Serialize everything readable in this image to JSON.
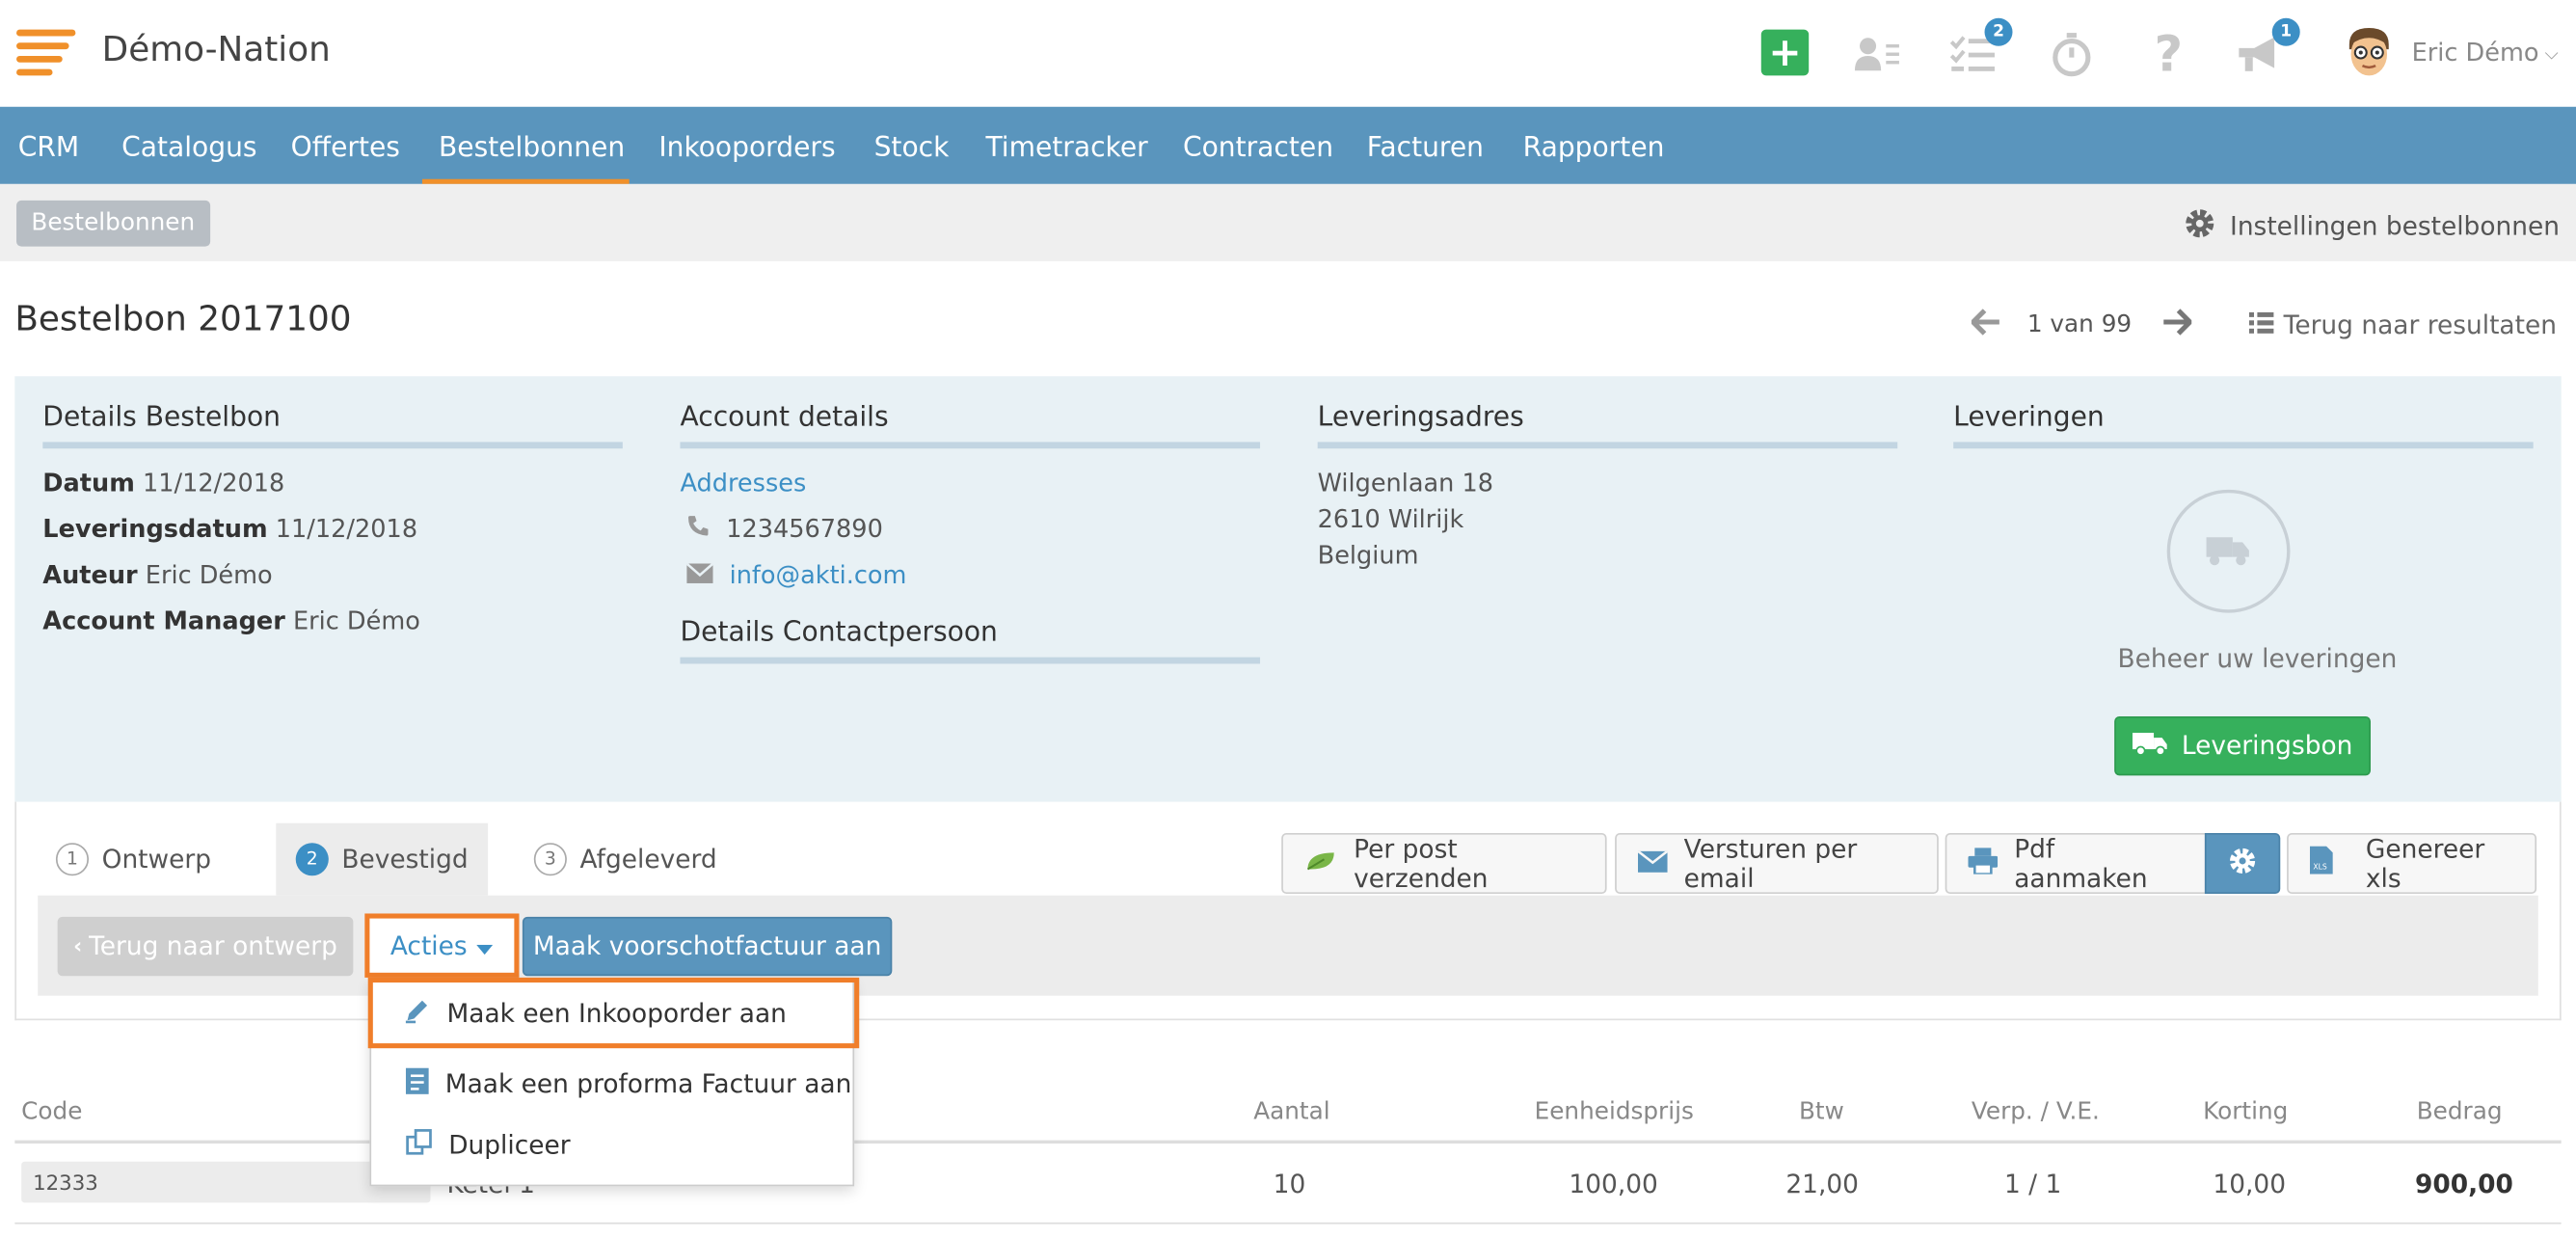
{
  "app": {
    "title": "Démo-Nation"
  },
  "topbar": {
    "tasks_badge": "2",
    "announce_badge": "1",
    "user_name": "Eric Démo"
  },
  "nav": [
    "CRM",
    "Catalogus",
    "Offertes",
    "Bestelbonnen",
    "Inkooporders",
    "Stock",
    "Timetracker",
    "Contracten",
    "Facturen",
    "Rapporten"
  ],
  "nav_active": "Bestelbonnen",
  "subbar": {
    "breadcrumb": "Bestelbonnen",
    "settings": "Instellingen bestelbonnen"
  },
  "page": {
    "title": "Bestelbon 2017100",
    "pager": "1 van 99",
    "back": "Terug naar resultaten"
  },
  "details": {
    "heading": "Details Bestelbon",
    "rows": [
      {
        "label": "Datum",
        "value": "11/12/2018"
      },
      {
        "label": "Leveringsdatum",
        "value": "11/12/2018"
      },
      {
        "label": "Auteur",
        "value": "Eric Démo"
      },
      {
        "label": "Account Manager",
        "value": "Eric Démo"
      }
    ]
  },
  "account": {
    "heading": "Account details",
    "addresses": "Addresses",
    "phone": "1234567890",
    "email": "info@akti.com",
    "contact_heading": "Details Contactpersoon"
  },
  "delivery_address": {
    "heading": "Leveringsadres",
    "lines": [
      "Wilgenlaan 18",
      "2610 Wilrijk",
      "Belgium"
    ]
  },
  "deliveries": {
    "heading": "Leveringen",
    "text": "Beheer uw leveringen",
    "button": "Leveringsbon"
  },
  "steps": [
    {
      "num": "1",
      "label": "Ontwerp"
    },
    {
      "num": "2",
      "label": "Bevestigd"
    },
    {
      "num": "3",
      "label": "Afgeleverd"
    }
  ],
  "toolbar": {
    "post": "Per post verzenden",
    "email": "Versturen per email",
    "pdf": "Pdf aanmaken",
    "xls": "Genereer xls"
  },
  "actions": {
    "back": "Terug naar ontwerp",
    "acties": "Acties",
    "voorschot": "Maak voorschotfactuur aan",
    "menu": [
      "Maak een Inkooporder aan",
      "Maak een proforma Factuur aan",
      "Dupliceer"
    ]
  },
  "table": {
    "headers": [
      "Code",
      "Aantal",
      "Eenheidsprijs",
      "Btw",
      "Verp. / V.E.",
      "Korting",
      "Bedrag"
    ],
    "row": {
      "code": "12333",
      "name": "Ketel 1",
      "aantal": "10",
      "prijs": "100,00",
      "btw": "21,00",
      "verp": "1 / 1",
      "korting": "10,00",
      "bedrag": "900,00"
    }
  },
  "colors": {
    "nav": "#5a95bd",
    "accent": "#f0902a",
    "green": "#36b05c",
    "highlight": "#f07e2a",
    "link": "#3c8fc5"
  }
}
